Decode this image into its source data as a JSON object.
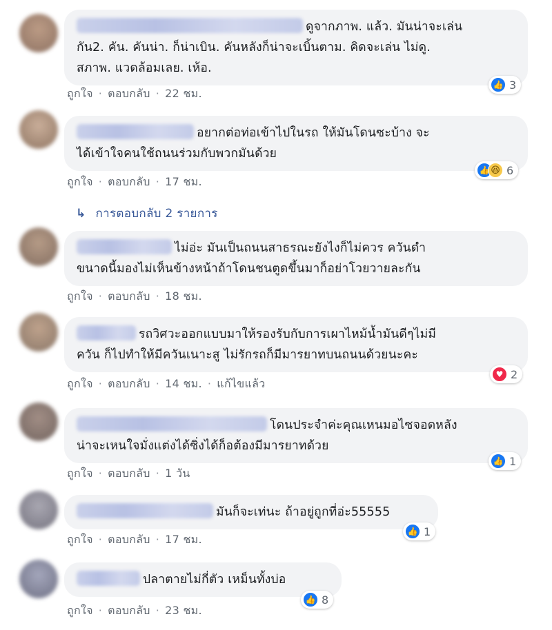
{
  "ui": {
    "like": "ถูกใจ",
    "reply": "ตอบกลับ",
    "separator": "·",
    "edited": "แก้ไขแล้ว"
  },
  "replies_link": {
    "arrow": "↳",
    "text": "การตอบกลับ 2 รายการ"
  },
  "comments": [
    {
      "avatar_color": "#8b6a55",
      "lines": [
        "ดูจากภาพ. แล้ว. มันน่าจะเล่น",
        "กัน2. คัน. คันน่า. ก็น่าเบิน. คันหลังก็น่าจะเบิ้นตาม. คิดจะเล่น ไม่ดู.",
        "สภาพ. แวดล้อมเลย. เห้อ."
      ],
      "time": "22 ชม.",
      "reaction_count": "3"
    },
    {
      "avatar_color": "#9a7b61",
      "lines": [
        "อยากต่อท่อเข้าไปในรถ ให้มันโดนซะบ้าง จะ",
        "ได้เข้าใจคนใช้ถนนร่วมกับพวกมันด้วย"
      ],
      "time": "17 ชม.",
      "reaction_count": "6"
    },
    {
      "avatar_color": "#7f6656",
      "lines": [
        "ไม่อ่ะ มันเป็นถนนสาธรณะยังไงก็ไม่ควร ควันดำ",
        "ขนาดนี้มองไม่เห็นข้างหน้าถ้าโดนชนตูดขึ้นมาก็อย่าโวยวายละกัน"
      ],
      "time": "18 ชม."
    },
    {
      "avatar_color": "#8d7560",
      "lines": [
        "รถวิศวะออกแบบมาให้รองรับกับการเผาไหม้น้ำมันดีๆไม่มี",
        "ควัน ก็ไปทำให้มีควันเนาะสู ไม่รักรถก็มีมารยาทบนถนนด้วยนะคะ"
      ],
      "time": "14 ชม.",
      "reaction_count": "2"
    },
    {
      "avatar_color": "#6f5f58",
      "lines": [
        "โดนประจำค่ะคุณเหนมอไซจอดหลัง",
        "น่าจะเหนใจมั่งแต่งได้ซิ่งได้ก็อต้องมีมารยาทด้วย"
      ],
      "time": "1 วัน",
      "reaction_count": "1"
    },
    {
      "avatar_color": "#75737e",
      "lines": [
        "มันก็จะเท่นะ ถ้าอยู่ถูกที่อ่ะ55555"
      ],
      "time": "17 ชม.",
      "reaction_count": "1"
    },
    {
      "avatar_color": "#6d6f84",
      "lines": [
        "ปลาตายไม่กี่ตัว เหม็นทั้งบ่อ"
      ],
      "time": "23 ชม.",
      "reaction_count": "8"
    }
  ]
}
